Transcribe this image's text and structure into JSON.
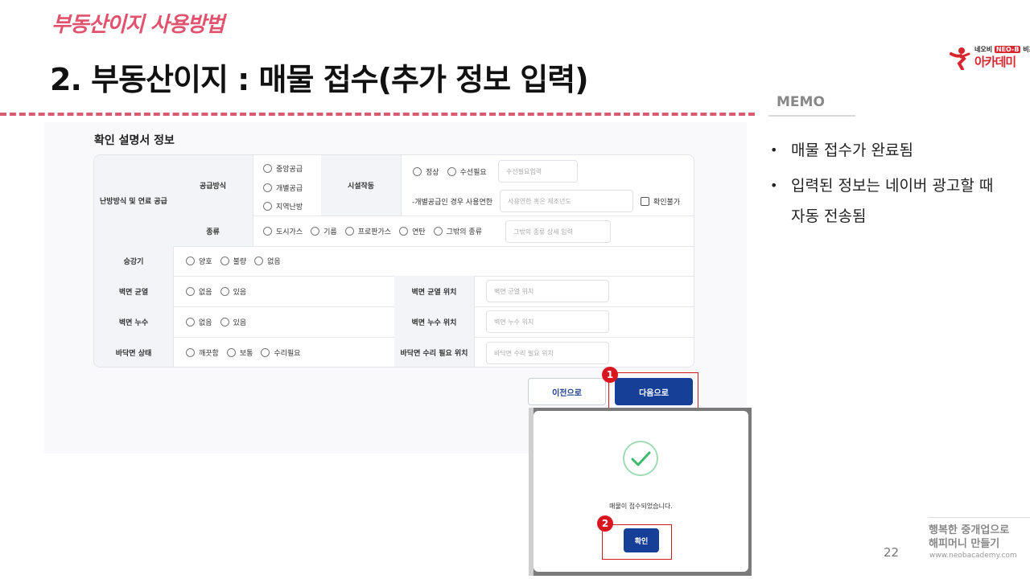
{
  "header": {
    "series_title": "부동산이지 사용방법",
    "page_title": "2. 부동산이지 : 매물 접수(추가 정보 입력)"
  },
  "logo": {
    "top_left": "네오비",
    "top_badge": "NEO-B",
    "top_right": "비즈",
    "main": "아카데미",
    "color": "#d8262f"
  },
  "memo": {
    "title": "MEMO",
    "items": [
      "매물 접수가 완료됨",
      "입력된 정보는 네이버 광고할 때 자동 전송됨"
    ]
  },
  "form": {
    "heading": "확인 설명서 정보",
    "heating": {
      "label": "난방방식 및 연료 공급",
      "supply_label": "공급방식",
      "supply_options": [
        "중앙공급",
        "개별공급",
        "지역난방"
      ],
      "operation_label": "시설작동",
      "operation_options": [
        "정상",
        "수선필요"
      ],
      "repair_placeholder": "수선필요입력",
      "individual_note": "-개별공급인 경우 사용연한",
      "lifespan_placeholder": "사용연한 혹은 제조년도",
      "unconfirmed_label": "확인불가",
      "fuel_label": "종류",
      "fuel_options": [
        "도시가스",
        "기름",
        "프로판가스",
        "연탄",
        "그밖의 종류"
      ],
      "other_fuel_placeholder": "그밖의 종류 상세 입력"
    },
    "elevator": {
      "label": "승강기",
      "options": [
        "양호",
        "불량",
        "없음"
      ]
    },
    "wall_crack": {
      "label": "벽면 균열",
      "options": [
        "없음",
        "있음"
      ],
      "location_label": "벽면 균열 위치",
      "location_placeholder": "벽면 균열 위치"
    },
    "wall_leak": {
      "label": "벽면 누수",
      "options": [
        "없음",
        "있음"
      ],
      "location_label": "벽면 누수 위치",
      "location_placeholder": "벽면 누수 위치"
    },
    "floor": {
      "label": "바닥면 상태",
      "options": [
        "깨끗함",
        "보통",
        "수리필요"
      ],
      "location_label": "바닥면 수리 필요 위치",
      "location_placeholder": "바닥면 수리 필요 위치"
    },
    "prev_button": "이전으로",
    "next_button": "다음으로",
    "step1": "1"
  },
  "modal": {
    "message": "매물이 접수되었습니다.",
    "ok_button": "확인",
    "step2": "2",
    "accent": "#3dba6c"
  },
  "footer": {
    "page_number": "22",
    "tagline_1": "행복한 중개업으로",
    "tagline_2": "해피머니 만들기",
    "url": "www.neobacademy.com"
  }
}
